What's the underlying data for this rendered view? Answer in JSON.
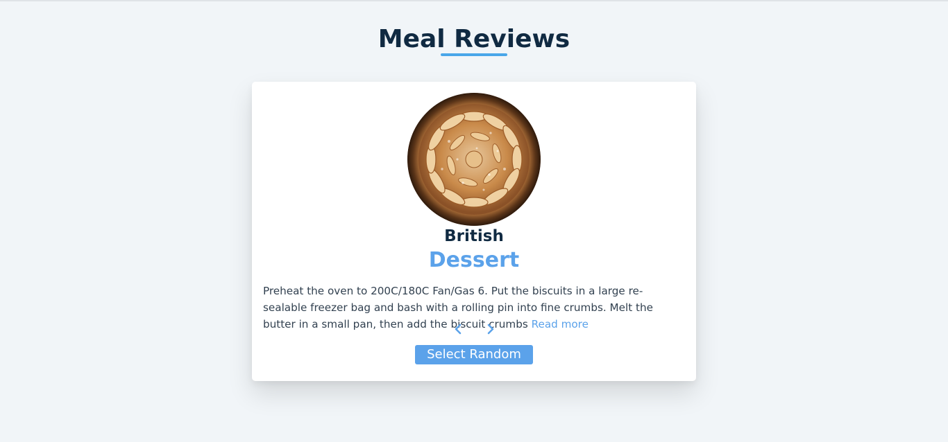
{
  "page": {
    "title": "Meal Reviews"
  },
  "meal": {
    "cuisine": "British",
    "category": "Dessert",
    "description": "Preheat the oven to 200C/180C Fan/Gas 6. Put the biscuits in a large re-sealable freezer bag and bash with a rolling pin into fine crumbs. Melt the butter in a small pan, then add the biscuit crumbs",
    "read_more": "Read more",
    "image_icon": "meal-photo"
  },
  "controls": {
    "prev_icon": "chevron-left-icon",
    "next_icon": "chevron-right-icon",
    "random_label": "Select Random"
  },
  "colors": {
    "accent": "#5ba2ea",
    "heading": "#102a42",
    "background": "#f1f5f8",
    "card": "#ffffff"
  }
}
